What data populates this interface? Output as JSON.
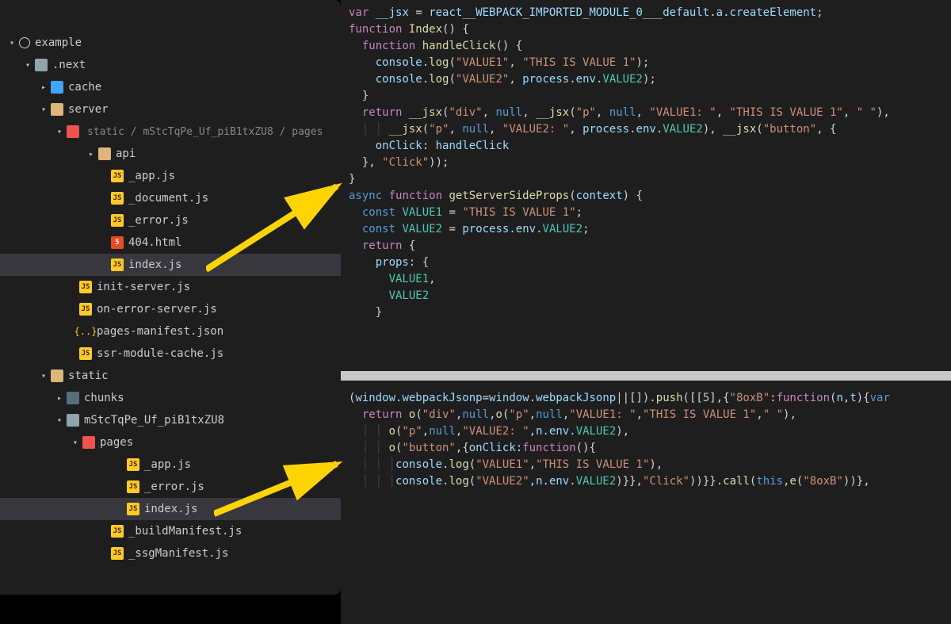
{
  "tree": {
    "root": "example",
    "next": ".next",
    "cache": "cache",
    "server": "server",
    "static_bc": "static / mStcTqPe_Uf_piB1txZU8 / pages",
    "api": "api",
    "app": "_app.js",
    "doc": "_document.js",
    "err": "_error.js",
    "404": "404.html",
    "idx": "index.js",
    "init": "init-server.js",
    "onerr": "on-error-server.js",
    "pman": "pages-manifest.json",
    "ssr": "ssr-module-cache.js",
    "static": "static",
    "chunks": "chunks",
    "hash": "mStcTqPe_Uf_piB1txZU8",
    "pages": "pages",
    "app2": "_app.js",
    "err2": "_error.js",
    "idx2": "index.js",
    "bman": "_buildManifest.js",
    "ssg": "_ssgManifest.js"
  },
  "icons": {
    "js": "JS",
    "json": "{..}",
    "html": "5"
  },
  "code1": [
    [
      [
        "kw",
        "var"
      ],
      [
        "p",
        " "
      ],
      [
        "id",
        "__jsx"
      ],
      [
        "p",
        " "
      ],
      [
        "op",
        "="
      ],
      [
        "p",
        " "
      ],
      [
        "id",
        "react__WEBPACK_IMPORTED_MODULE_0___default"
      ],
      [
        "p",
        "."
      ],
      [
        "id",
        "a"
      ],
      [
        "p",
        "."
      ],
      [
        "id",
        "createElement"
      ],
      [
        "p",
        ";"
      ]
    ],
    [
      [
        "kw",
        "function"
      ],
      [
        "p",
        " "
      ],
      [
        "fn",
        "Index"
      ],
      [
        "p",
        "() {"
      ]
    ],
    [
      [
        "p",
        "  "
      ],
      [
        "kw",
        "function"
      ],
      [
        "p",
        " "
      ],
      [
        "fn",
        "handleClick"
      ],
      [
        "p",
        "() {"
      ]
    ],
    [
      [
        "p",
        "    "
      ],
      [
        "id",
        "console"
      ],
      [
        "p",
        "."
      ],
      [
        "fn",
        "log"
      ],
      [
        "p",
        "("
      ],
      [
        "str",
        "\"VALUE1\""
      ],
      [
        "p",
        ", "
      ],
      [
        "str",
        "\"THIS IS VALUE 1\""
      ],
      [
        "p",
        ");"
      ]
    ],
    [
      [
        "p",
        "    "
      ],
      [
        "id",
        "console"
      ],
      [
        "p",
        "."
      ],
      [
        "fn",
        "log"
      ],
      [
        "p",
        "("
      ],
      [
        "str",
        "\"VALUE2\""
      ],
      [
        "p",
        ", "
      ],
      [
        "id",
        "process"
      ],
      [
        "p",
        "."
      ],
      [
        "id",
        "env"
      ],
      [
        "p",
        "."
      ],
      [
        "type",
        "VALUE2"
      ],
      [
        "p",
        ");"
      ]
    ],
    [
      [
        "p",
        "  }"
      ]
    ],
    [
      [
        "p",
        ""
      ]
    ],
    [
      [
        "p",
        "  "
      ],
      [
        "kw",
        "return"
      ],
      [
        "p",
        " "
      ],
      [
        "fn",
        "__jsx"
      ],
      [
        "p",
        "("
      ],
      [
        "str",
        "\"div\""
      ],
      [
        "p",
        ", "
      ],
      [
        "var",
        "null"
      ],
      [
        "p",
        ", "
      ],
      [
        "fn",
        "__jsx"
      ],
      [
        "p",
        "("
      ],
      [
        "str",
        "\"p\""
      ],
      [
        "p",
        ", "
      ],
      [
        "var",
        "null"
      ],
      [
        "p",
        ", "
      ],
      [
        "str",
        "\"VALUE1: \""
      ],
      [
        "p",
        ", "
      ],
      [
        "str",
        "\"THIS IS VALUE 1\""
      ],
      [
        "p",
        ", "
      ],
      [
        "str",
        "\" \""
      ],
      [
        "p",
        "),"
      ]
    ],
    [
      [
        "guide",
        "  │ │ "
      ],
      [
        "fn",
        "__jsx"
      ],
      [
        "p",
        "("
      ],
      [
        "str",
        "\"p\""
      ],
      [
        "p",
        ", "
      ],
      [
        "var",
        "null"
      ],
      [
        "p",
        ", "
      ],
      [
        "str",
        "\"VALUE2: \""
      ],
      [
        "p",
        ", "
      ],
      [
        "id",
        "process"
      ],
      [
        "p",
        "."
      ],
      [
        "id",
        "env"
      ],
      [
        "p",
        "."
      ],
      [
        "type",
        "VALUE2"
      ],
      [
        "p",
        "), "
      ],
      [
        "fn",
        "__jsx"
      ],
      [
        "p",
        "("
      ],
      [
        "str",
        "\"button\""
      ],
      [
        "p",
        ", {"
      ]
    ],
    [
      [
        "p",
        "    "
      ],
      [
        "id",
        "onClick"
      ],
      [
        "p",
        ": "
      ],
      [
        "id",
        "handleClick"
      ]
    ],
    [
      [
        "p",
        "  }, "
      ],
      [
        "str",
        "\"Click\""
      ],
      [
        "p",
        "));"
      ]
    ],
    [
      [
        "p",
        "}"
      ]
    ],
    [
      [
        "var",
        "async"
      ],
      [
        "p",
        " "
      ],
      [
        "kw",
        "function"
      ],
      [
        "p",
        " "
      ],
      [
        "fn",
        "getServerSideProps"
      ],
      [
        "p",
        "("
      ],
      [
        "id",
        "context"
      ],
      [
        "p",
        ") {"
      ]
    ],
    [
      [
        "p",
        "  "
      ],
      [
        "var",
        "const"
      ],
      [
        "p",
        " "
      ],
      [
        "type",
        "VALUE1"
      ],
      [
        "p",
        " "
      ],
      [
        "op",
        "="
      ],
      [
        "p",
        " "
      ],
      [
        "str",
        "\"THIS IS VALUE 1\""
      ],
      [
        "p",
        ";"
      ]
    ],
    [
      [
        "p",
        "  "
      ],
      [
        "var",
        "const"
      ],
      [
        "p",
        " "
      ],
      [
        "type",
        "VALUE2"
      ],
      [
        "p",
        " "
      ],
      [
        "op",
        "="
      ],
      [
        "p",
        " "
      ],
      [
        "id",
        "process"
      ],
      [
        "p",
        "."
      ],
      [
        "id",
        "env"
      ],
      [
        "p",
        "."
      ],
      [
        "type",
        "VALUE2"
      ],
      [
        "p",
        ";"
      ]
    ],
    [
      [
        "p",
        "  "
      ],
      [
        "kw",
        "return"
      ],
      [
        "p",
        " {"
      ]
    ],
    [
      [
        "p",
        "    "
      ],
      [
        "id",
        "props"
      ],
      [
        "p",
        ": {"
      ]
    ],
    [
      [
        "p",
        "      "
      ],
      [
        "type",
        "VALUE1"
      ],
      [
        "p",
        ","
      ]
    ],
    [
      [
        "p",
        "      "
      ],
      [
        "type",
        "VALUE2"
      ]
    ],
    [
      [
        "p",
        "    }"
      ]
    ]
  ],
  "code2": [
    [
      [
        "p",
        "("
      ],
      [
        "id",
        "window"
      ],
      [
        "p",
        "."
      ],
      [
        "id",
        "webpackJsonp"
      ],
      [
        "op",
        "="
      ],
      [
        "id",
        "window"
      ],
      [
        "p",
        "."
      ],
      [
        "id",
        "webpackJsonp"
      ],
      [
        "op",
        "||"
      ],
      [
        "p",
        "[])."
      ],
      [
        "fn",
        "push"
      ],
      [
        "p",
        "([["
      ],
      [
        "num",
        "5"
      ],
      [
        "p",
        "],{"
      ],
      [
        "str",
        "\"8oxB\""
      ],
      [
        "p",
        ":"
      ],
      [
        "kw",
        "function"
      ],
      [
        "p",
        "("
      ],
      [
        "id",
        "n"
      ],
      [
        "p",
        ","
      ],
      [
        "id",
        "t"
      ],
      [
        "p",
        "){"
      ],
      [
        "var",
        "var"
      ]
    ],
    [
      [
        "p",
        ""
      ]
    ],
    [
      [
        "p",
        "  "
      ],
      [
        "kw",
        "return"
      ],
      [
        "p",
        " "
      ],
      [
        "fn",
        "o"
      ],
      [
        "p",
        "("
      ],
      [
        "str",
        "\"div\""
      ],
      [
        "p",
        ","
      ],
      [
        "var",
        "null"
      ],
      [
        "p",
        ","
      ],
      [
        "fn",
        "o"
      ],
      [
        "p",
        "("
      ],
      [
        "str",
        "\"p\""
      ],
      [
        "p",
        ","
      ],
      [
        "var",
        "null"
      ],
      [
        "p",
        ","
      ],
      [
        "str",
        "\"VALUE1: \""
      ],
      [
        "p",
        ","
      ],
      [
        "str",
        "\"THIS IS VALUE 1\""
      ],
      [
        "p",
        ","
      ],
      [
        "str",
        "\" \""
      ],
      [
        "p",
        "),"
      ]
    ],
    [
      [
        "guide",
        "  │ │ "
      ],
      [
        "fn",
        "o"
      ],
      [
        "p",
        "("
      ],
      [
        "str",
        "\"p\""
      ],
      [
        "p",
        ","
      ],
      [
        "var",
        "null"
      ],
      [
        "p",
        ","
      ],
      [
        "str",
        "\"VALUE2: \""
      ],
      [
        "p",
        ","
      ],
      [
        "id",
        "n"
      ],
      [
        "p",
        "."
      ],
      [
        "id",
        "env"
      ],
      [
        "p",
        "."
      ],
      [
        "type",
        "VALUE2"
      ],
      [
        "p",
        "),"
      ]
    ],
    [
      [
        "guide",
        "  │ │ "
      ],
      [
        "fn",
        "o"
      ],
      [
        "p",
        "("
      ],
      [
        "str",
        "\"button\""
      ],
      [
        "p",
        ",{"
      ],
      [
        "id",
        "onClick"
      ],
      [
        "p",
        ":"
      ],
      [
        "kw",
        "function"
      ],
      [
        "p",
        "(){"
      ]
    ],
    [
      [
        "guide",
        "  │ │ │"
      ],
      [
        "id",
        "console"
      ],
      [
        "p",
        "."
      ],
      [
        "fn",
        "log"
      ],
      [
        "p",
        "("
      ],
      [
        "str",
        "\"VALUE1\""
      ],
      [
        "p",
        ","
      ],
      [
        "str",
        "\"THIS IS VALUE 1\""
      ],
      [
        "p",
        "),"
      ]
    ],
    [
      [
        "guide",
        "  │ │ │"
      ],
      [
        "id",
        "console"
      ],
      [
        "p",
        "."
      ],
      [
        "fn",
        "log"
      ],
      [
        "p",
        "("
      ],
      [
        "str",
        "\"VALUE2\""
      ],
      [
        "p",
        ","
      ],
      [
        "id",
        "n"
      ],
      [
        "p",
        "."
      ],
      [
        "id",
        "env"
      ],
      [
        "p",
        "."
      ],
      [
        "type",
        "VALUE2"
      ],
      [
        "p",
        ")}},"
      ],
      [
        "str",
        "\"Click\""
      ],
      [
        "p",
        "))}}."
      ],
      [
        "fn",
        "call"
      ],
      [
        "p",
        "("
      ],
      [
        "var",
        "this"
      ],
      [
        "p",
        ","
      ],
      [
        "fn",
        "e"
      ],
      [
        "p",
        "("
      ],
      [
        "str",
        "\"8oxB\""
      ],
      [
        "p",
        "))},"
      ]
    ]
  ]
}
